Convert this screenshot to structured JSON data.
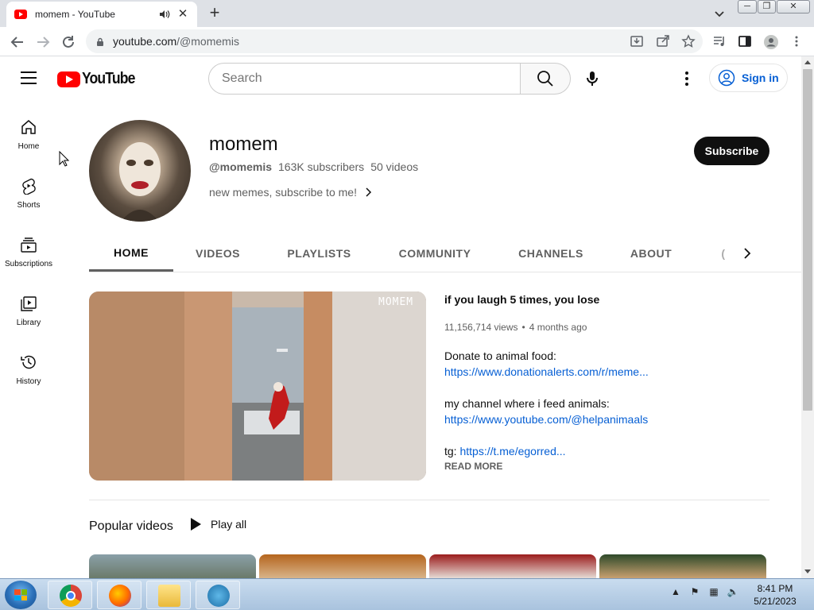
{
  "browser": {
    "tab_title": "momem - YouTube",
    "url_host": "youtube.com",
    "url_path": "/@momemis"
  },
  "masthead": {
    "logo_text": "YouTube",
    "search_placeholder": "Search",
    "signin_label": "Sign in"
  },
  "guide": {
    "items": [
      {
        "label": "Home",
        "icon": "home-icon"
      },
      {
        "label": "Shorts",
        "icon": "shorts-icon"
      },
      {
        "label": "Subscriptions",
        "icon": "subscriptions-icon"
      },
      {
        "label": "Library",
        "icon": "library-icon"
      },
      {
        "label": "History",
        "icon": "history-icon"
      }
    ]
  },
  "channel": {
    "name": "momem",
    "handle": "@momemis",
    "subscribers": "163K subscribers",
    "videos": "50 videos",
    "description": "new memes, subscribe to me!",
    "subscribe_label": "Subscribe"
  },
  "tabs": [
    {
      "label": "HOME",
      "active": true
    },
    {
      "label": "VIDEOS",
      "active": false
    },
    {
      "label": "PLAYLISTS",
      "active": false
    },
    {
      "label": "COMMUNITY",
      "active": false
    },
    {
      "label": "CHANNELS",
      "active": false
    },
    {
      "label": "ABOUT",
      "active": false
    }
  ],
  "featured": {
    "watermark": "MOMEM",
    "title": "if you laugh 5 times, you lose",
    "views": "11,156,714 views",
    "separator": "•",
    "age": "4 months ago",
    "desc_line1": "Donate to animal food:",
    "desc_link1": "https://www.donationalerts.com/r/meme...",
    "desc_line2": "my channel where i feed animals:",
    "desc_link2": "https://www.youtube.com/@helpanimaals",
    "desc_tg_label": "tg:",
    "desc_tg_link": "https://t.me/egorred...",
    "read_more": "READ MORE"
  },
  "popular": {
    "title": "Popular videos",
    "play_all": "Play all"
  },
  "taskbar": {
    "time": "8:41 PM",
    "date": "5/21/2023"
  },
  "colors": {
    "youtube_red": "#ff0000",
    "link_blue": "#065fd4",
    "subscribe_bg": "#0f0f0f"
  }
}
